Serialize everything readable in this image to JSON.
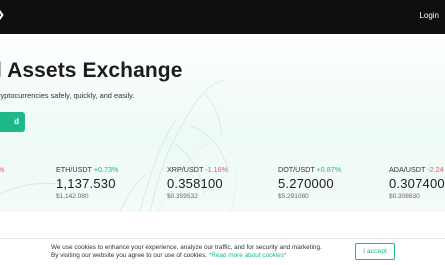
{
  "nav": {
    "login_label": "Login"
  },
  "hero": {
    "headline": "l Assets Exchange",
    "subline": "ryptocurrencies safely, quickly, and easily.",
    "cta_label": "d"
  },
  "tickers": [
    {
      "pair": "ETH/USDT",
      "change": "+0.73%",
      "trend": "up",
      "price": "1,137.530",
      "usd": "$1,142.080"
    },
    {
      "pair": "XRP/USDT",
      "change": "-1.16%",
      "trend": "down",
      "price": "0.358100",
      "usd": "$0.359532"
    },
    {
      "pair": "DOT/USDT",
      "change": "+0.87%",
      "trend": "up",
      "price": "5.270000",
      "usd": "$5.291080"
    },
    {
      "pair": "ADA/USDT",
      "change": "-2.24",
      "trend": "down",
      "price": "0.307400",
      "usd": "$0.308630"
    }
  ],
  "partial_ticker_change": "%",
  "cookie": {
    "line1": "We use cookies to enhance your experience, analyze our traffic, and for security and marketing.",
    "line2_prefix": "By visiting our website you agree to our use of cookies.",
    "link_label": "*Read more about cookies*",
    "accept_label": "I accept"
  },
  "colors": {
    "accent": "#1fb88a",
    "negative": "#e05c5c",
    "topbar": "#0f0f0f"
  }
}
